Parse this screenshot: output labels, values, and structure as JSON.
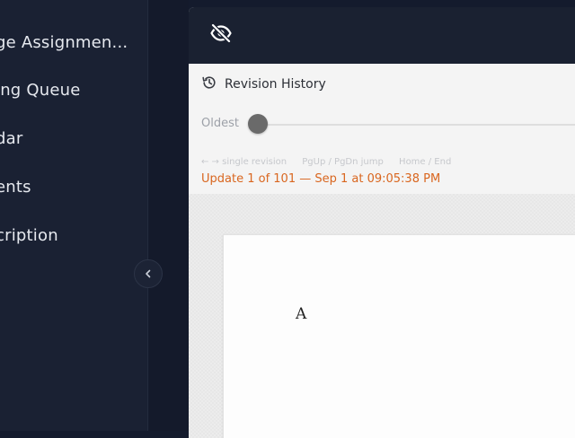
{
  "sidebar": {
    "items": [
      {
        "label": "ge Assignmen..."
      },
      {
        "label": "ing Queue"
      },
      {
        "label": "dar"
      },
      {
        "label": "ents"
      },
      {
        "label": "cription"
      }
    ],
    "collapse_icon": "chevron-left-icon"
  },
  "panel": {
    "topbar": {
      "visibility_icon": "eye-off-icon"
    },
    "revision_history": {
      "icon": "history-icon",
      "title": "Revision History",
      "slider": {
        "start_label": "Oldest",
        "position_fraction": 0
      },
      "hints": [
        "← → single revision",
        "PgUp / PgDn jump",
        "Home / End"
      ],
      "update_status": "Update 1 of 101 — Sep 1 at 09:05:38 PM"
    },
    "document": {
      "content": "A"
    }
  },
  "colors": {
    "sidebar_bg": "#1a2133",
    "topbar_bg": "#1a2131",
    "accent_orange": "#d9661f",
    "slider_thumb": "#6a6a6a"
  }
}
